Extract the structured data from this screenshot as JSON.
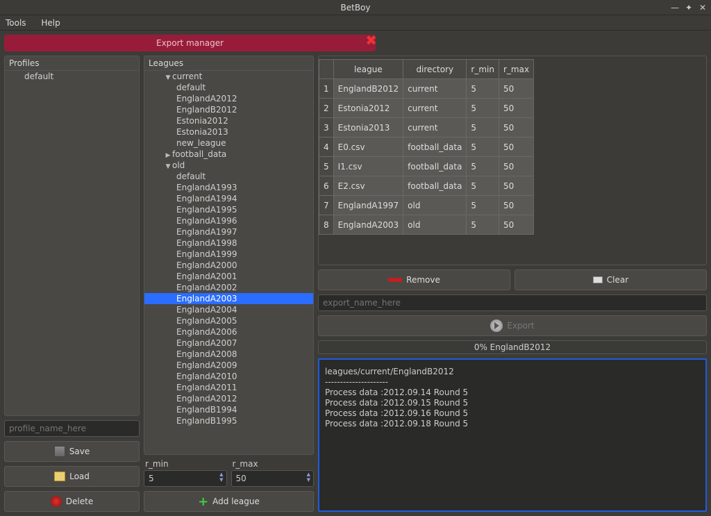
{
  "window": {
    "title": "BetBoy"
  },
  "menu": {
    "tools": "Tools",
    "help": "Help"
  },
  "banner": {
    "label": "Export manager"
  },
  "profiles": {
    "header": "Profiles",
    "items": [
      "default"
    ],
    "name_placeholder": "profile_name_here",
    "save": "Save",
    "load": "Load",
    "delete": "Delete"
  },
  "leagues": {
    "header": "Leagues",
    "rmin_label": "r_min",
    "rmax_label": "r_max",
    "rmin_value": "5",
    "rmax_value": "50",
    "add_league": "Add league",
    "tree": [
      {
        "label": "current",
        "level": 0,
        "arrow": "▼"
      },
      {
        "label": "default",
        "level": 1
      },
      {
        "label": "EnglandA2012",
        "level": 1
      },
      {
        "label": "EnglandB2012",
        "level": 1
      },
      {
        "label": "Estonia2012",
        "level": 1
      },
      {
        "label": "Estonia2013",
        "level": 1
      },
      {
        "label": "new_league",
        "level": 1
      },
      {
        "label": "football_data",
        "level": 0,
        "arrow": "▶"
      },
      {
        "label": "old",
        "level": 0,
        "arrow": "▼"
      },
      {
        "label": "default",
        "level": 1
      },
      {
        "label": "EnglandA1993",
        "level": 1
      },
      {
        "label": "EnglandA1994",
        "level": 1
      },
      {
        "label": "EnglandA1995",
        "level": 1
      },
      {
        "label": "EnglandA1996",
        "level": 1
      },
      {
        "label": "EnglandA1997",
        "level": 1
      },
      {
        "label": "EnglandA1998",
        "level": 1
      },
      {
        "label": "EnglandA1999",
        "level": 1
      },
      {
        "label": "EnglandA2000",
        "level": 1
      },
      {
        "label": "EnglandA2001",
        "level": 1
      },
      {
        "label": "EnglandA2002",
        "level": 1
      },
      {
        "label": "EnglandA2003",
        "level": 1,
        "selected": true
      },
      {
        "label": "EnglandA2004",
        "level": 1
      },
      {
        "label": "EnglandA2005",
        "level": 1
      },
      {
        "label": "EnglandA2006",
        "level": 1
      },
      {
        "label": "EnglandA2007",
        "level": 1
      },
      {
        "label": "EnglandA2008",
        "level": 1
      },
      {
        "label": "EnglandA2009",
        "level": 1
      },
      {
        "label": "EnglandA2010",
        "level": 1
      },
      {
        "label": "EnglandA2011",
        "level": 1
      },
      {
        "label": "EnglandA2012",
        "level": 1
      },
      {
        "label": "EnglandB1994",
        "level": 1
      },
      {
        "label": "EnglandB1995",
        "level": 1
      }
    ]
  },
  "table": {
    "columns": [
      "",
      "league",
      "directory",
      "r_min",
      "r_max"
    ],
    "rows": [
      [
        "1",
        "EnglandB2012",
        "current",
        "5",
        "50"
      ],
      [
        "2",
        "Estonia2012",
        "current",
        "5",
        "50"
      ],
      [
        "3",
        "Estonia2013",
        "current",
        "5",
        "50"
      ],
      [
        "4",
        "E0.csv",
        "football_data",
        "5",
        "50"
      ],
      [
        "5",
        "I1.csv",
        "football_data",
        "5",
        "50"
      ],
      [
        "6",
        "E2.csv",
        "football_data",
        "5",
        "50"
      ],
      [
        "7",
        "EnglandA1997",
        "old",
        "5",
        "50"
      ],
      [
        "8",
        "EnglandA2003",
        "old",
        "5",
        "50"
      ]
    ]
  },
  "actions": {
    "remove": "Remove",
    "clear": "Clear",
    "export_placeholder": "export_name_here",
    "export": "Export"
  },
  "progress": {
    "text": "0% EnglandB2012"
  },
  "log": "leagues/current/EnglandB2012\n---------------------\nProcess data :2012.09.14 Round 5\nProcess data :2012.09.15 Round 5\nProcess data :2012.09.16 Round 5\nProcess data :2012.09.18 Round 5"
}
